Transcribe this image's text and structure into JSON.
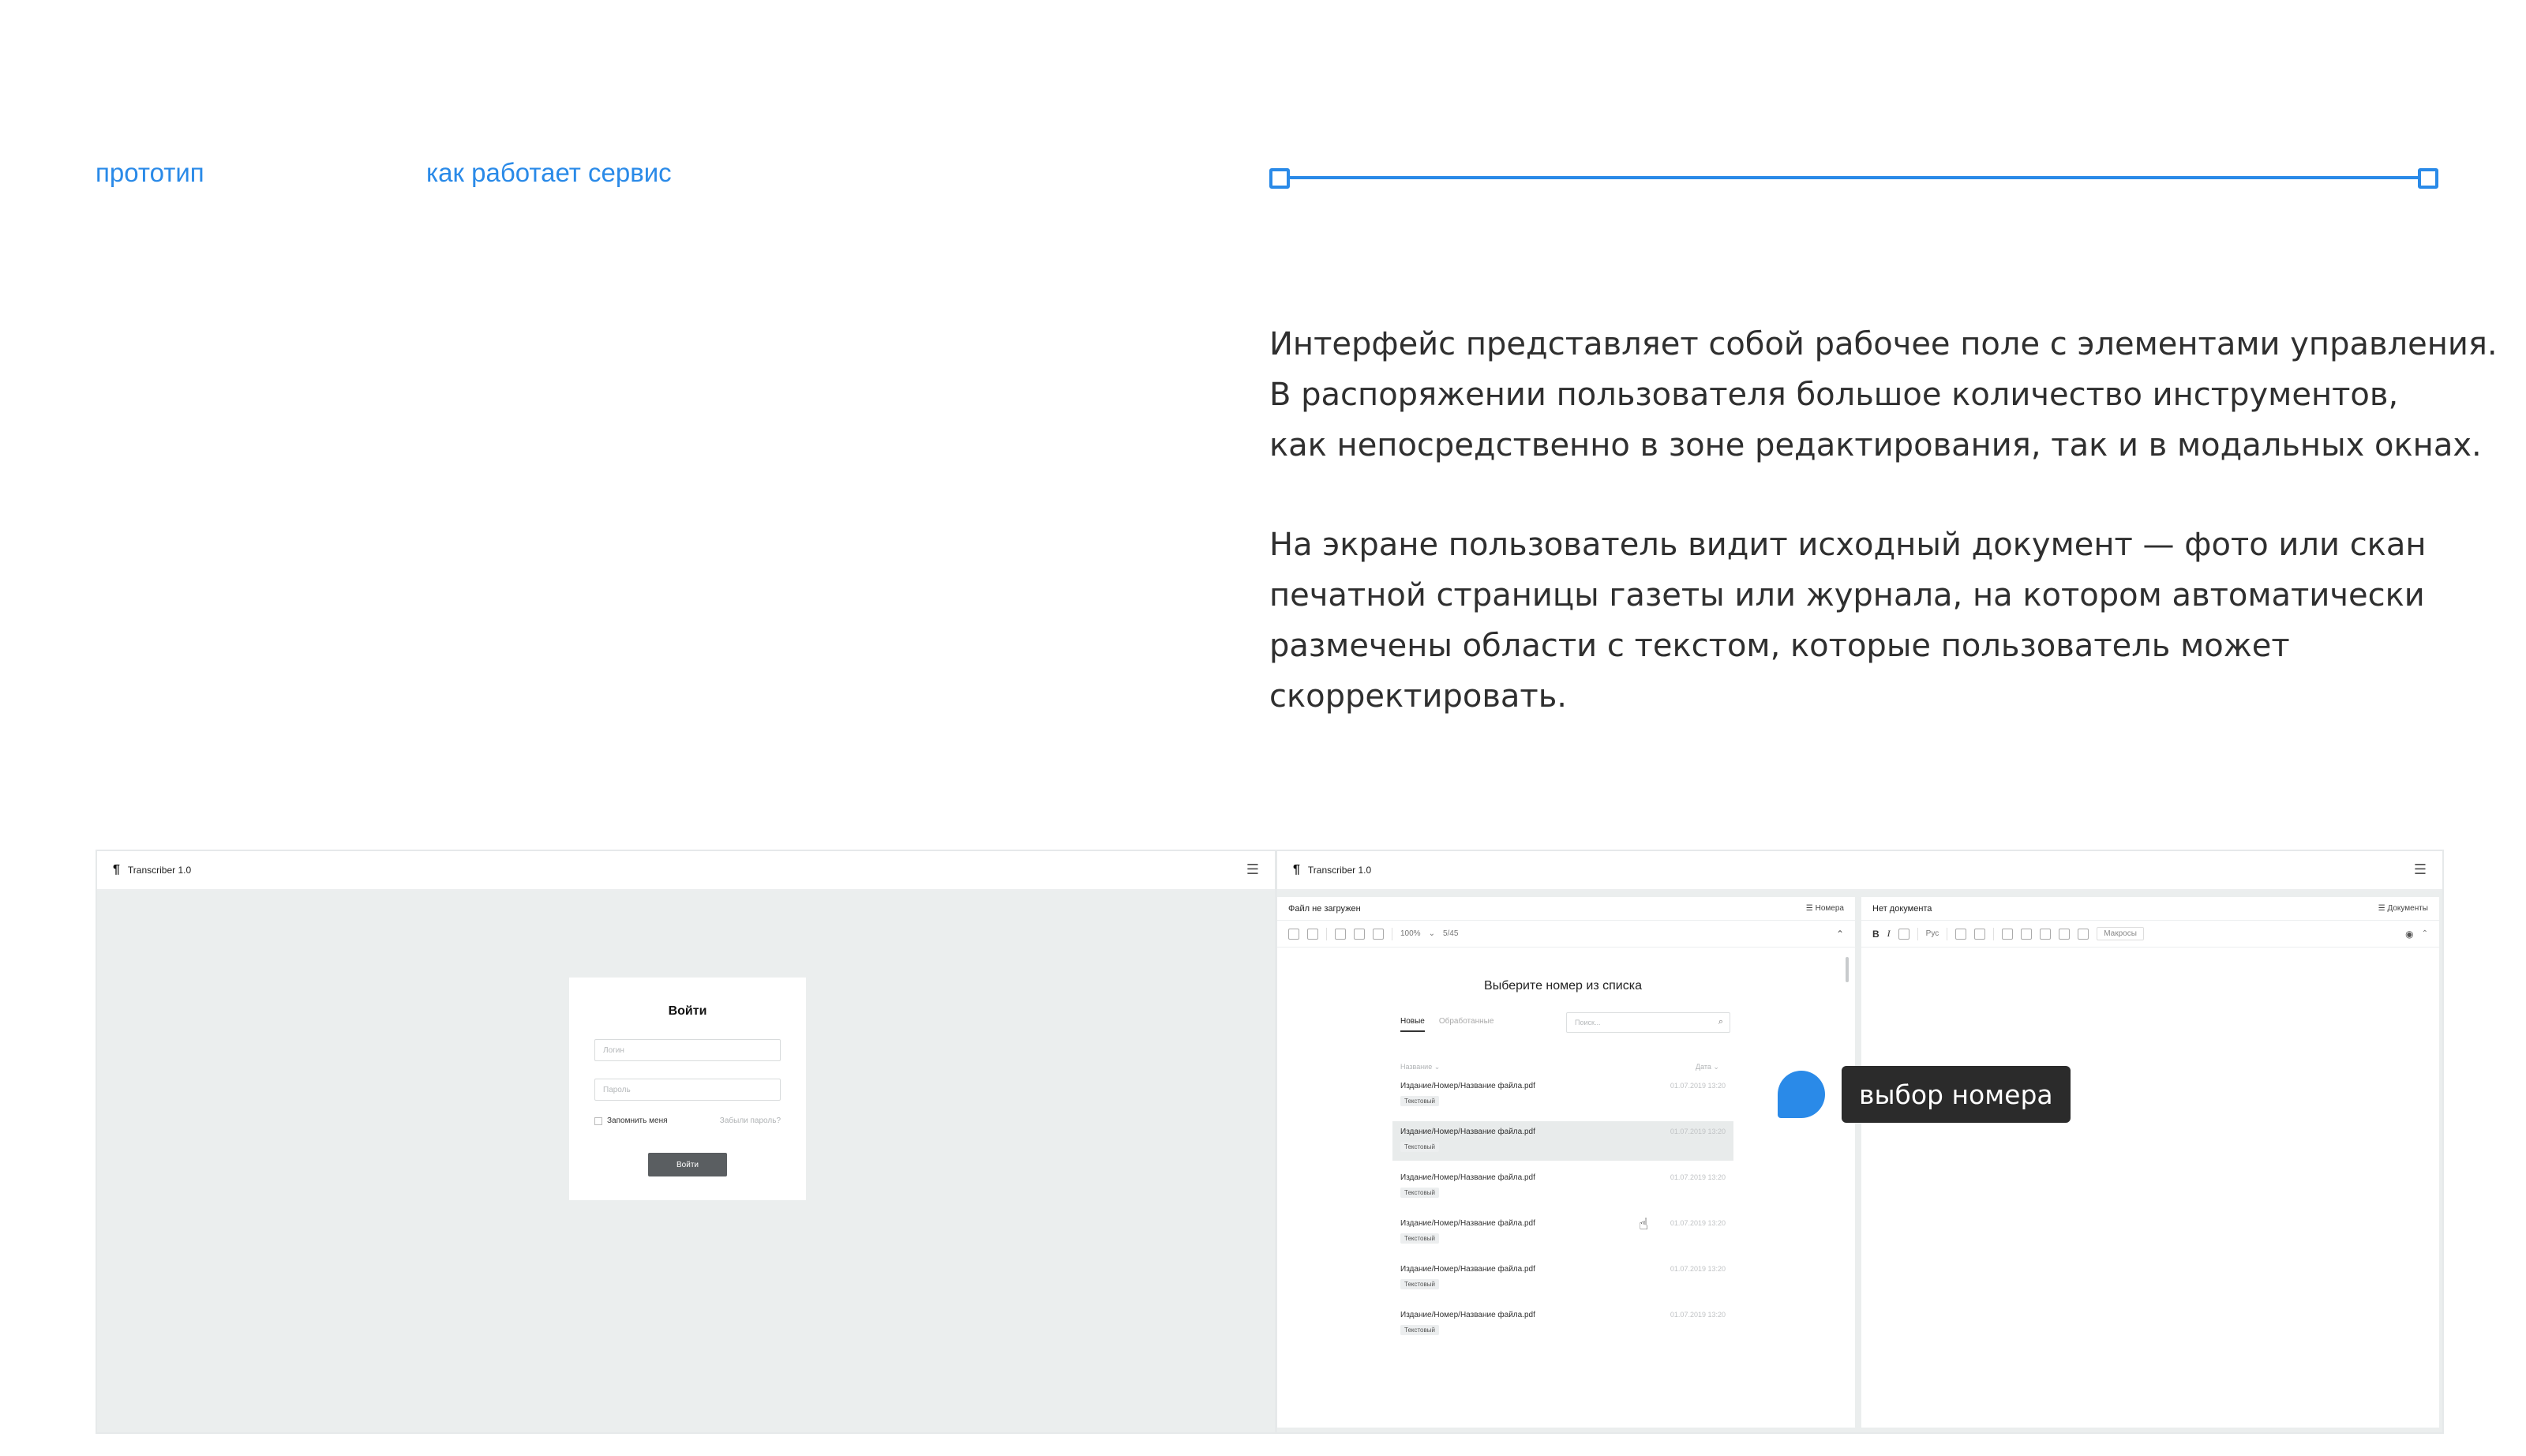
{
  "nav": {
    "prototype_label": "прототип",
    "how_label": "как работает сервис"
  },
  "description": {
    "paragraph_1": [
      "Интерфейс представляет собой рабочее поле с элементами управления.",
      "В распоряжении пользователя большое количество инструментов,",
      "как непосредственно в зоне редактирования, так и в модальных окнах."
    ],
    "paragraph_2": [
      "На экране пользователь видит исходный документ — фото или скан",
      "печатной страницы газеты или журнала, на котором автоматически",
      "размечены области с текстом, которые пользователь может",
      "скорректировать."
    ]
  },
  "login_screen": {
    "app_title": "Transcriber 1.0",
    "logo_glyph": "¶",
    "menu_glyph": "☰",
    "card_title": "Войти",
    "login_placeholder": "Логин",
    "password_placeholder": "Пароль",
    "remember_label": "Запомнить меня",
    "forgot_label": "Забыли пароль?",
    "submit_label": "Войти"
  },
  "app_screen": {
    "app_title": "Transcriber 1.0",
    "logo_glyph": "¶",
    "menu_glyph": "☰",
    "left_pane": {
      "status": "Файл не загружен",
      "issues_button": "☰ Номера",
      "zoom": "100%",
      "pages": "5/45",
      "heading": "Выберите номер из списка",
      "tabs": [
        "Новые",
        "Обработанные"
      ],
      "search_placeholder": "Поиск...",
      "col_name": "Название ⌄",
      "col_date": "Дата ⌄",
      "rows": [
        {
          "name": "Издание/Номер/Название файла.pdf",
          "date": "01.07.2019 13:20",
          "tag": "Текстовый"
        },
        {
          "name": "Издание/Номер/Название файла.pdf",
          "date": "01.07.2019 13:20",
          "tag": "Текстовый"
        },
        {
          "name": "Издание/Номер/Название файла.pdf",
          "date": "01.07.2019 13:20",
          "tag": "Текстовый"
        },
        {
          "name": "Издание/Номер/Название файла.pdf",
          "date": "01.07.2019 13:20",
          "tag": "Текстовый"
        },
        {
          "name": "Издание/Номер/Название файла.pdf",
          "date": "01.07.2019 13:20",
          "tag": "Текстовый"
        },
        {
          "name": "Издание/Номер/Название файла.pdf",
          "date": "01.07.2019 13:20",
          "tag": "Текстовый"
        }
      ],
      "selected_row": 1
    },
    "right_pane": {
      "status": "Нет документа",
      "documents_button": "☰ Документы",
      "lang": "Рус",
      "macros": "Макросы"
    }
  },
  "annotation": {
    "label": "выбор номера",
    "color": "#2a8ae8"
  },
  "colors": {
    "accent": "#2a8ae8",
    "text": "#2f2f2f",
    "canvas": "#ebeeee"
  }
}
